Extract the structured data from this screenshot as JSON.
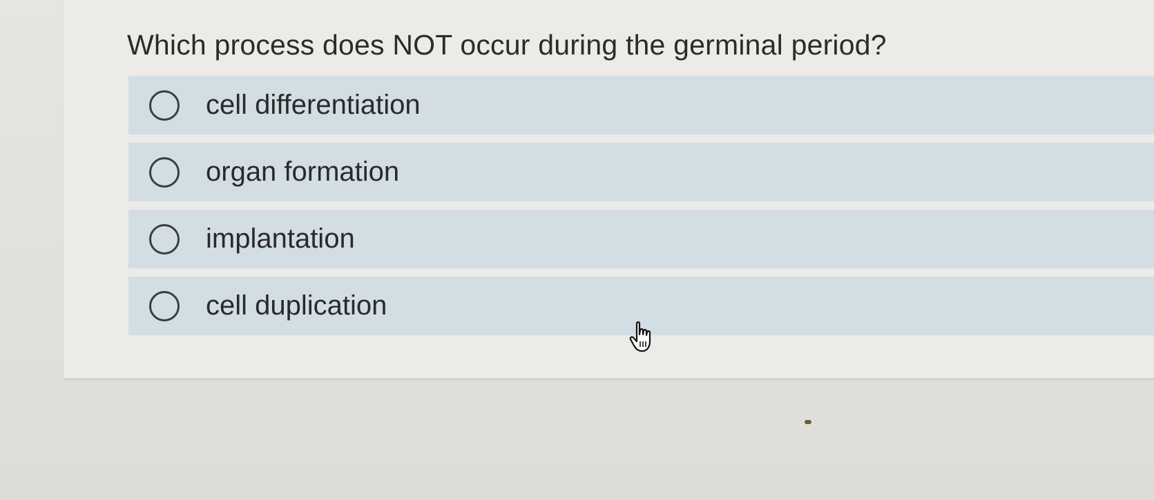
{
  "quiz": {
    "question": "Which process does NOT occur during the germinal period?",
    "options": [
      {
        "label": "cell differentiation",
        "selected": false
      },
      {
        "label": "organ formation",
        "selected": false
      },
      {
        "label": "implantation",
        "selected": false
      },
      {
        "label": "cell duplication",
        "selected": false
      }
    ]
  },
  "icons": {
    "radio": "radio-unselected-icon",
    "cursor": "hand-pointer-icon"
  },
  "colors": {
    "option_background": "#d2dde4",
    "card_background": "#ecebe8",
    "text": "#2a2a2a"
  }
}
